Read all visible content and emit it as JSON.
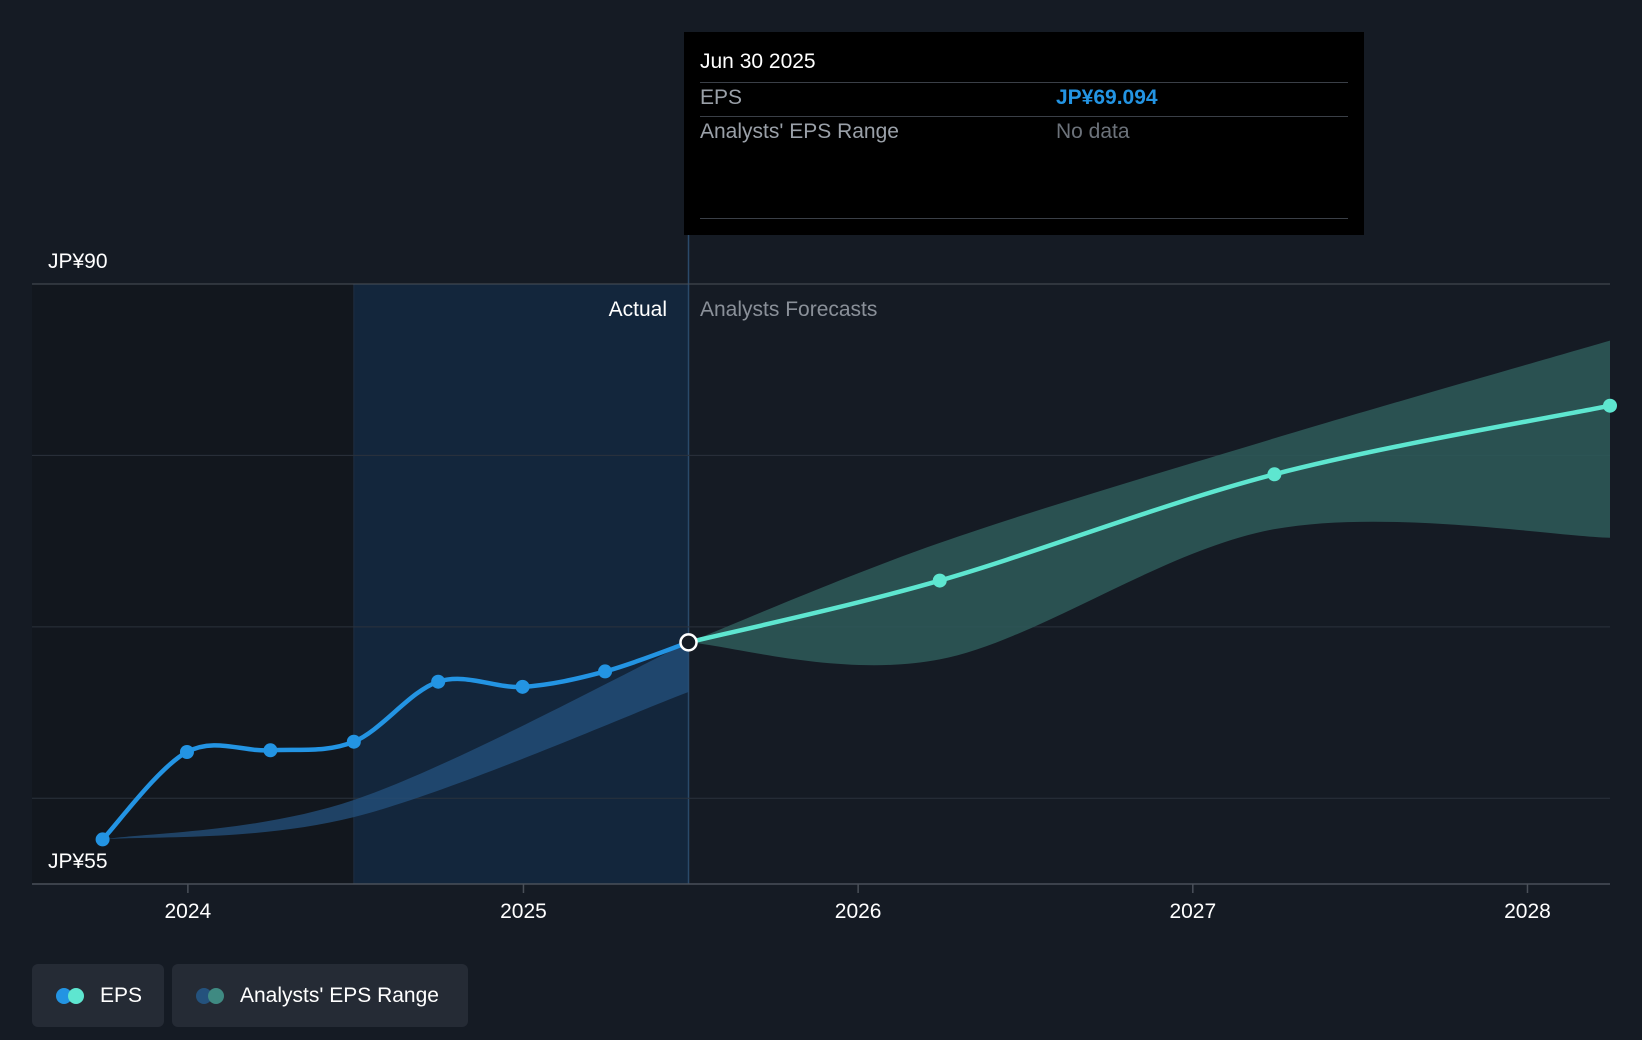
{
  "tooltip": {
    "date": "Jun 30 2025",
    "rows": [
      {
        "label": "EPS",
        "value": "JP¥69.094"
      },
      {
        "label": "Analysts' EPS Range",
        "value": "No data"
      }
    ]
  },
  "legend": {
    "items": [
      {
        "label": "EPS"
      },
      {
        "label": "Analysts' EPS Range"
      }
    ]
  },
  "colors": {
    "background": "#151b24",
    "actual_line": "#2394e3",
    "forecast_line": "#5ee6d0",
    "forecast_band": "#2e5a59",
    "actual_band": "#24527d",
    "actual_region": "#13263c"
  },
  "chart_data": {
    "type": "line",
    "y_axis_labels": [
      "JP¥90",
      "JP¥55"
    ],
    "ylim": [
      55,
      90
    ],
    "xlim": [
      "2023-07-15",
      "2028-03-31"
    ],
    "x_ticks": [
      "2024",
      "2025",
      "2026",
      "2027",
      "2028"
    ],
    "region_labels": {
      "actual": "Actual",
      "forecast": "Analysts Forecasts"
    },
    "series": [
      {
        "name": "EPS",
        "kind": "actual",
        "points": [
          {
            "x": "2023-09-30",
            "y": 57.6
          },
          {
            "x": "2023-12-31",
            "y": 62.7
          },
          {
            "x": "2024-03-31",
            "y": 62.8
          },
          {
            "x": "2024-06-30",
            "y": 63.3
          },
          {
            "x": "2024-09-30",
            "y": 66.8
          },
          {
            "x": "2024-12-31",
            "y": 66.5
          },
          {
            "x": "2025-03-31",
            "y": 67.4
          },
          {
            "x": "2025-06-30",
            "y": 69.094
          }
        ]
      },
      {
        "name": "EPS",
        "kind": "forecast",
        "points": [
          {
            "x": "2025-06-30",
            "y": 69.094
          },
          {
            "x": "2026-03-31",
            "y": 72.7
          },
          {
            "x": "2027-03-31",
            "y": 78.9
          },
          {
            "x": "2028-03-31",
            "y": 82.9
          }
        ]
      }
    ],
    "range_bands": [
      {
        "name": "Analysts' EPS Range",
        "kind": "past",
        "upper": [
          {
            "x": "2023-09-30",
            "y": 57.6
          },
          {
            "x": "2024-06-30",
            "y": 59.9
          },
          {
            "x": "2025-06-30",
            "y": 69.094
          }
        ],
        "lower": [
          {
            "x": "2023-09-30",
            "y": 57.6
          },
          {
            "x": "2024-06-30",
            "y": 58.9
          },
          {
            "x": "2025-06-30",
            "y": 66.2
          }
        ]
      },
      {
        "name": "Analysts' EPS Range",
        "kind": "forecast",
        "upper": [
          {
            "x": "2025-06-30",
            "y": 69.094
          },
          {
            "x": "2026-03-31",
            "y": 74.9
          },
          {
            "x": "2027-03-31",
            "y": 81.0
          },
          {
            "x": "2028-03-31",
            "y": 86.7
          }
        ],
        "lower": [
          {
            "x": "2025-06-30",
            "y": 69.094
          },
          {
            "x": "2026-03-31",
            "y": 68.1
          },
          {
            "x": "2027-03-31",
            "y": 75.7
          },
          {
            "x": "2028-03-31",
            "y": 75.2
          }
        ]
      }
    ],
    "highlight": {
      "x": "2025-06-30",
      "y": 69.094
    },
    "past_region_start": "2024-06-30",
    "grid": true
  }
}
